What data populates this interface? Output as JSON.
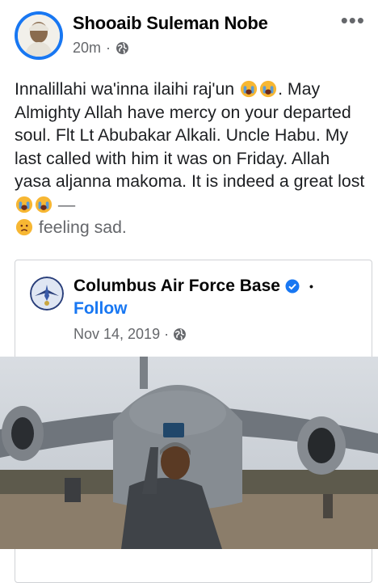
{
  "post": {
    "author": "Shooaib Suleman Nobe",
    "time": "20m",
    "separator": "·",
    "more_label": "•••",
    "text_1": "Innalillahi wa'inna ilaihi raj'un ",
    "text_2": ". May Almighty Allah have mercy on your departed soul. Flt Lt Abubakar Alkali. Uncle Habu. My last called with him it was on Friday. Allah yasa aljanna makoma. It is indeed a great lost ",
    "text_3": " — ",
    "feeling": " feeling sad."
  },
  "shared": {
    "page_name": "Columbus Air Force Base",
    "dot": "•",
    "follow_label": "Follow",
    "date": "Nov 14, 2019",
    "separator": "·"
  },
  "icons": {
    "privacy": "globe-icon",
    "verified": "verified-badge-icon",
    "emoji": "crying-face-emoji",
    "feeling": "sad-face-emoji"
  },
  "colors": {
    "accent": "#1877f2",
    "secondary_text": "#65676b",
    "emoji": "#f7b733"
  }
}
